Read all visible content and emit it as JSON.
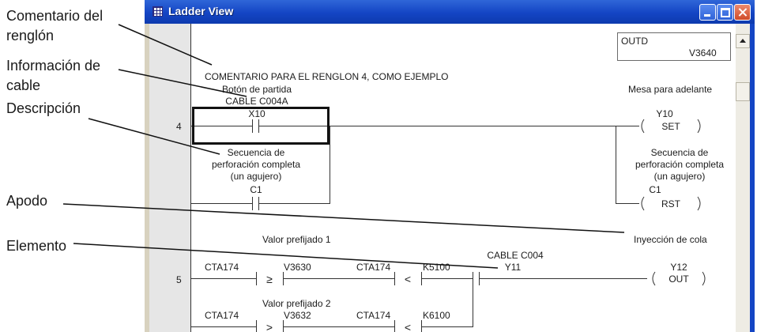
{
  "annotations": {
    "rung_comment": [
      "Comentario del",
      "renglón"
    ],
    "wire_info": [
      "Información de",
      "cable"
    ],
    "description": "Descripción",
    "nickname": "Apodo",
    "element": "Elemento"
  },
  "window": {
    "title": "Ladder View",
    "buttons": {
      "minimize": "minimize",
      "maximize": "maximize",
      "close": "close"
    }
  },
  "ladder": {
    "outd_box": {
      "label": "OUTD",
      "value": "V3640"
    },
    "rung4": {
      "number": "4",
      "comment": "COMENTARIO PARA EL RENGLON 4, COMO EJEMPLO",
      "contact_x10": {
        "description": "Botón de partida",
        "wire_info": "CABLE C004A",
        "address": "X10"
      },
      "contact_c1": {
        "description": [
          "Secuencia de",
          "perforación completa",
          "(un agujero)"
        ],
        "address": "C1"
      },
      "coil_y10": {
        "description": "Mesa para adelante",
        "address": "Y10",
        "instruction": "SET"
      },
      "coil_c1": {
        "description": [
          "Secuencia de",
          "perforación completa",
          "(un agujero)"
        ],
        "address": "C1",
        "instruction": "RST"
      }
    },
    "rung5": {
      "number": "5",
      "preset_label": "Valor prefijado 1",
      "compare1": {
        "left": "CTA174",
        "op": "≥",
        "right": "V3630"
      },
      "compare2": {
        "left": "CTA174",
        "op": "<",
        "right": "K5100"
      },
      "contact_y11": {
        "wire_info": "CABLE C004",
        "address": "Y11"
      },
      "coil_y12": {
        "description": "Inyección de cola",
        "address": "Y12",
        "instruction": "OUT"
      },
      "branch": {
        "preset_label": "Valor prefijado 2",
        "compare1": {
          "left": "CTA174",
          "op": ">",
          "right": "V3632"
        },
        "compare2": {
          "left": "CTA174",
          "op": "<",
          "right": "K6100"
        }
      }
    }
  },
  "colors": {
    "titlebar": "#1445c4",
    "frame": "#d8d2bf",
    "gutter": "#e6e6e6"
  },
  "icons": [
    "ladder-view-window-icon",
    "minimize-icon",
    "maximize-icon",
    "close-icon",
    "scroll-up-arrow-icon"
  ]
}
